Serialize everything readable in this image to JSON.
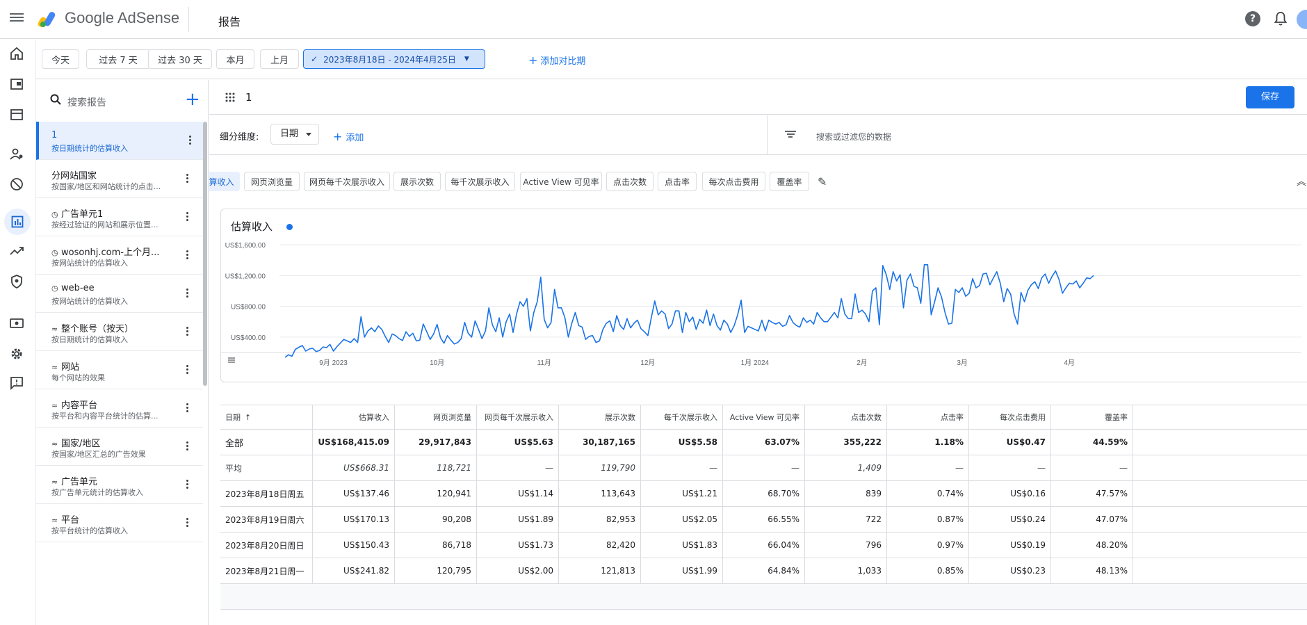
{
  "header": {
    "brand": "Google AdSense",
    "page_title": "报告"
  },
  "date_bar": {
    "presets": [
      "今天",
      "过去 7 天",
      "过去 30 天",
      "本月",
      "上月"
    ],
    "range": "2023年8月18日 - 2024年4月25日",
    "add_compare": "添加对比期"
  },
  "sidebar": {
    "search_placeholder": "搜索报告",
    "items": [
      {
        "title": "1",
        "subtitle": "按日期统计的估算收入",
        "icon": ""
      },
      {
        "title": "分网站国家",
        "subtitle": "按国家/地区和网站统计的点击...",
        "icon": ""
      },
      {
        "title": "广告单元1",
        "subtitle": "按经过验证的网站和展示位置...",
        "icon": "clock-icon"
      },
      {
        "title": "wosonhj.com-上个月...",
        "subtitle": "按网站统计的估算收入",
        "icon": "clock-icon"
      },
      {
        "title": "web-ee",
        "subtitle": "按网站统计的估算收入",
        "icon": "clock-icon"
      },
      {
        "title": "整个账号（按天）",
        "subtitle": "按日期统计的估算收入",
        "icon": "sparkline-icon"
      },
      {
        "title": "网站",
        "subtitle": "每个网站的效果",
        "icon": "sparkline-icon"
      },
      {
        "title": "内容平台",
        "subtitle": "按平台和内容平台统计的估算...",
        "icon": "sparkline-icon"
      },
      {
        "title": "国家/地区",
        "subtitle": "按国家/地区汇总的广告效果",
        "icon": "sparkline-icon"
      },
      {
        "title": "广告单元",
        "subtitle": "按广告单元统计的估算收入",
        "icon": "sparkline-icon"
      },
      {
        "title": "平台",
        "subtitle": "按平台统计的估算收入",
        "icon": "sparkline-icon"
      }
    ]
  },
  "report": {
    "name": "1",
    "save_label": "保存",
    "dimension_label": "细分维度:",
    "dimension_value": "日期",
    "add_label": "添加",
    "filter_placeholder": "搜索或过滤您的数据"
  },
  "metrics": [
    "估算收入",
    "网页浏览量",
    "网页每千次展示收入",
    "展示次数",
    "每千次展示收入",
    "Active View 可见率",
    "点击次数",
    "点击率",
    "每次点击费用",
    "覆盖率"
  ],
  "chart_data": {
    "type": "line",
    "title": "估算收入",
    "series_color": "#1a73e8",
    "y_ticks": [
      "US$400.00",
      "US$800.00",
      "US$1,200.00",
      "US$1,600.00"
    ],
    "ylim": [
      200,
      1700
    ],
    "x_tick_labels": [
      "9月 2023",
      "10月",
      "11月",
      "12月",
      "1月 2024",
      "2月",
      "3月",
      "4月"
    ],
    "x_tick_days": [
      14,
      44,
      75,
      105,
      136,
      167,
      196,
      227
    ],
    "values": [
      137,
      170,
      150,
      242,
      268,
      290,
      218,
      245,
      255,
      212,
      226,
      272,
      262,
      305,
      218,
      275,
      322,
      370,
      350,
      330,
      380,
      330,
      665,
      400,
      480,
      520,
      470,
      545,
      500,
      410,
      330,
      440,
      420,
      380,
      355,
      470,
      410,
      450,
      350,
      360,
      570,
      470,
      370,
      440,
      565,
      390,
      320,
      420,
      360,
      310,
      330,
      380,
      590,
      450,
      400,
      610,
      500,
      380,
      480,
      780,
      560,
      470,
      650,
      400,
      600,
      700,
      460,
      700,
      860,
      800,
      900,
      480,
      720,
      860,
      1180,
      630,
      520,
      590,
      1020,
      780,
      780,
      650,
      400,
      580,
      720,
      550,
      530,
      370,
      410,
      420,
      330,
      350,
      500,
      580,
      610,
      470,
      680,
      550,
      500,
      640,
      520,
      580,
      620,
      510,
      470,
      420,
      650,
      870,
      690,
      740,
      700,
      510,
      570,
      740,
      740,
      460,
      720,
      600,
      660,
      500,
      630,
      580,
      750,
      550,
      700,
      550,
      490,
      620,
      570,
      460,
      550,
      690,
      880,
      460,
      540,
      520,
      500,
      480,
      620,
      480,
      620,
      590,
      570,
      590,
      540,
      560,
      680,
      590,
      550,
      530,
      650,
      590,
      620,
      570,
      720,
      650,
      600,
      600,
      660,
      720,
      650,
      900,
      700,
      640,
      640,
      960,
      720,
      750,
      700,
      600,
      1000,
      1040,
      560,
      1330,
      1210,
      1020,
      1250,
      1130,
      1210,
      780,
      1140,
      1220,
      1060,
      1040,
      840,
      1340,
      1340,
      690,
      860,
      1040,
      920,
      720,
      570,
      580,
      1020,
      980,
      1040,
      930,
      970,
      1160,
      1040,
      1070,
      1220,
      1230,
      1080,
      1170,
      1250,
      1100,
      860,
      1030,
      960,
      700,
      570,
      980,
      860,
      1010,
      1080,
      1120,
      1030,
      1170,
      1220,
      1100,
      1190,
      1260,
      1150,
      970,
      1040,
      1100,
      1090,
      1130,
      1040,
      1100,
      1170,
      1160,
      1200
    ]
  },
  "table": {
    "headers": [
      "日期",
      "估算收入",
      "网页浏览量",
      "网页每千次展示收入",
      "展示次数",
      "每千次展示收入",
      "Active View 可见率",
      "点击次数",
      "点击率",
      "每次点击费用",
      "覆盖率"
    ],
    "sort_arrow": "↑",
    "rows": [
      [
        "全部",
        "US$168,415.09",
        "29,917,843",
        "US$5.63",
        "30,187,165",
        "US$5.58",
        "63.07%",
        "355,222",
        "1.18%",
        "US$0.47",
        "44.59%"
      ],
      [
        "平均",
        "US$668.31",
        "118,721",
        "—",
        "119,790",
        "—",
        "—",
        "1,409",
        "—",
        "—",
        "—"
      ],
      [
        "2023年8月18日周五",
        "US$137.46",
        "120,941",
        "US$1.14",
        "113,643",
        "US$1.21",
        "68.70%",
        "839",
        "0.74%",
        "US$0.16",
        "47.57%"
      ],
      [
        "2023年8月19日周六",
        "US$170.13",
        "90,208",
        "US$1.89",
        "82,953",
        "US$2.05",
        "66.55%",
        "722",
        "0.87%",
        "US$0.24",
        "47.07%"
      ],
      [
        "2023年8月20日周日",
        "US$150.43",
        "86,718",
        "US$1.73",
        "82,420",
        "US$1.83",
        "66.04%",
        "796",
        "0.97%",
        "US$0.19",
        "48.20%"
      ],
      [
        "2023年8月21日周一",
        "US$241.82",
        "120,795",
        "US$2.00",
        "121,813",
        "US$1.99",
        "64.84%",
        "1,033",
        "0.85%",
        "US$0.23",
        "48.13%"
      ]
    ]
  }
}
